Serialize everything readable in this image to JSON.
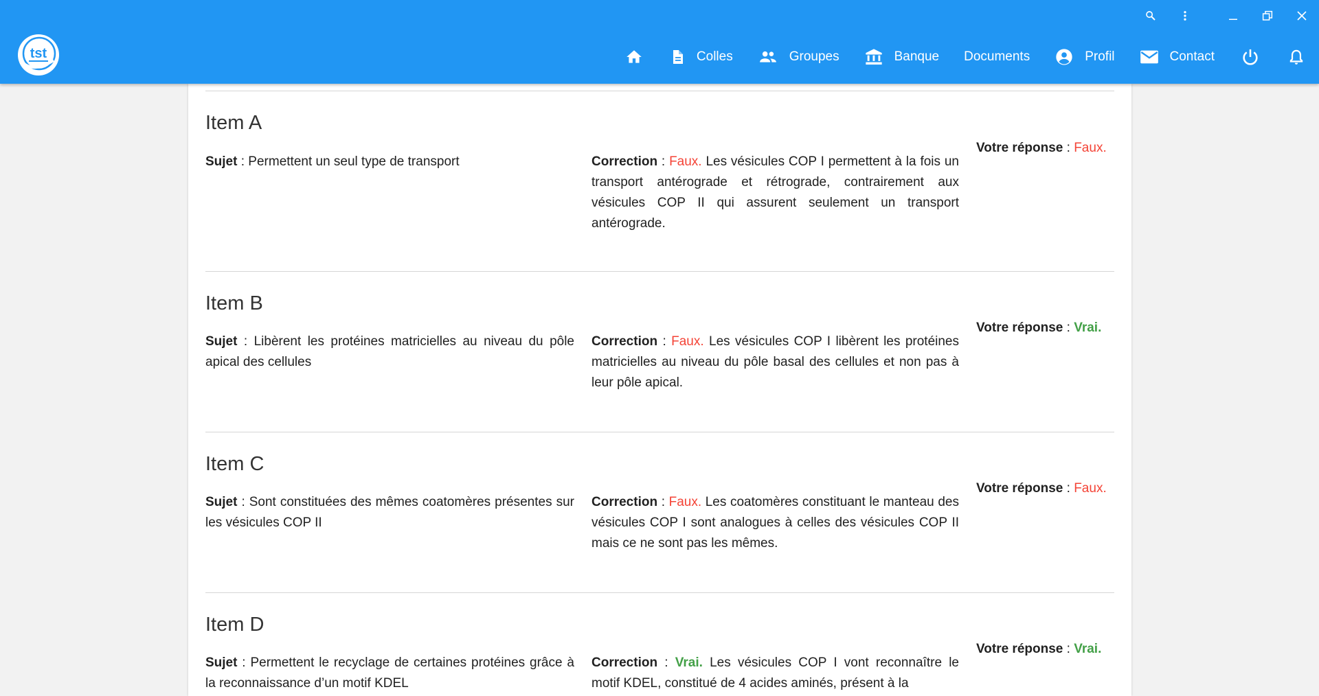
{
  "header": {
    "colors": {
      "primary": "#2196f3",
      "faux": "#f44336",
      "vrai": "#43a047"
    },
    "window_controls": [
      "search-icon",
      "more-vert-icon",
      "minimize-icon",
      "restore-icon",
      "close-icon"
    ],
    "nav": {
      "colles": "Colles",
      "groupes": "Groupes",
      "banque": "Banque",
      "documents": "Documents",
      "profil": "Profil",
      "contact": "Contact"
    }
  },
  "labels": {
    "sujet": "Sujet",
    "correction": "Correction",
    "votre_reponse": "Votre réponse",
    "sep": " : "
  },
  "items": [
    {
      "title": "Item A",
      "subject": "Permettent un seul type de transport",
      "correction_verdict": "Faux.",
      "correction_text": " Les vésicules COP I permettent à la fois un transport antérograde et rétrograde, contrairement aux vésicules COP II qui assurent seulement un transport antérograde.",
      "answer": "Faux."
    },
    {
      "title": "Item B",
      "subject": "Libèrent les protéines matricielles au niveau du pôle apical des cellules",
      "correction_verdict": "Faux.",
      "correction_text": " Les vésicules COP I libèrent les protéines matricielles au niveau du pôle basal des cellules et non pas à leur pôle apical.",
      "answer": "Vrai."
    },
    {
      "title": "Item C",
      "subject": "Sont constituées des mêmes coatomères présentes sur les vésicules COP II",
      "correction_verdict": "Faux.",
      "correction_text": " Les coatomères constituant le manteau des vésicules COP I sont analogues à celles des vésicules COP II mais ce ne sont pas les mêmes.",
      "answer": "Faux."
    },
    {
      "title": "Item D",
      "subject": "Permettent le recyclage de certaines protéines grâce à la reconnaissance d’un motif KDEL",
      "correction_verdict": "Vrai.",
      "correction_text": " Les vésicules COP I vont reconnaître le motif KDEL, constitué de 4 acides aminés, présent à la",
      "answer": "Vrai."
    }
  ]
}
